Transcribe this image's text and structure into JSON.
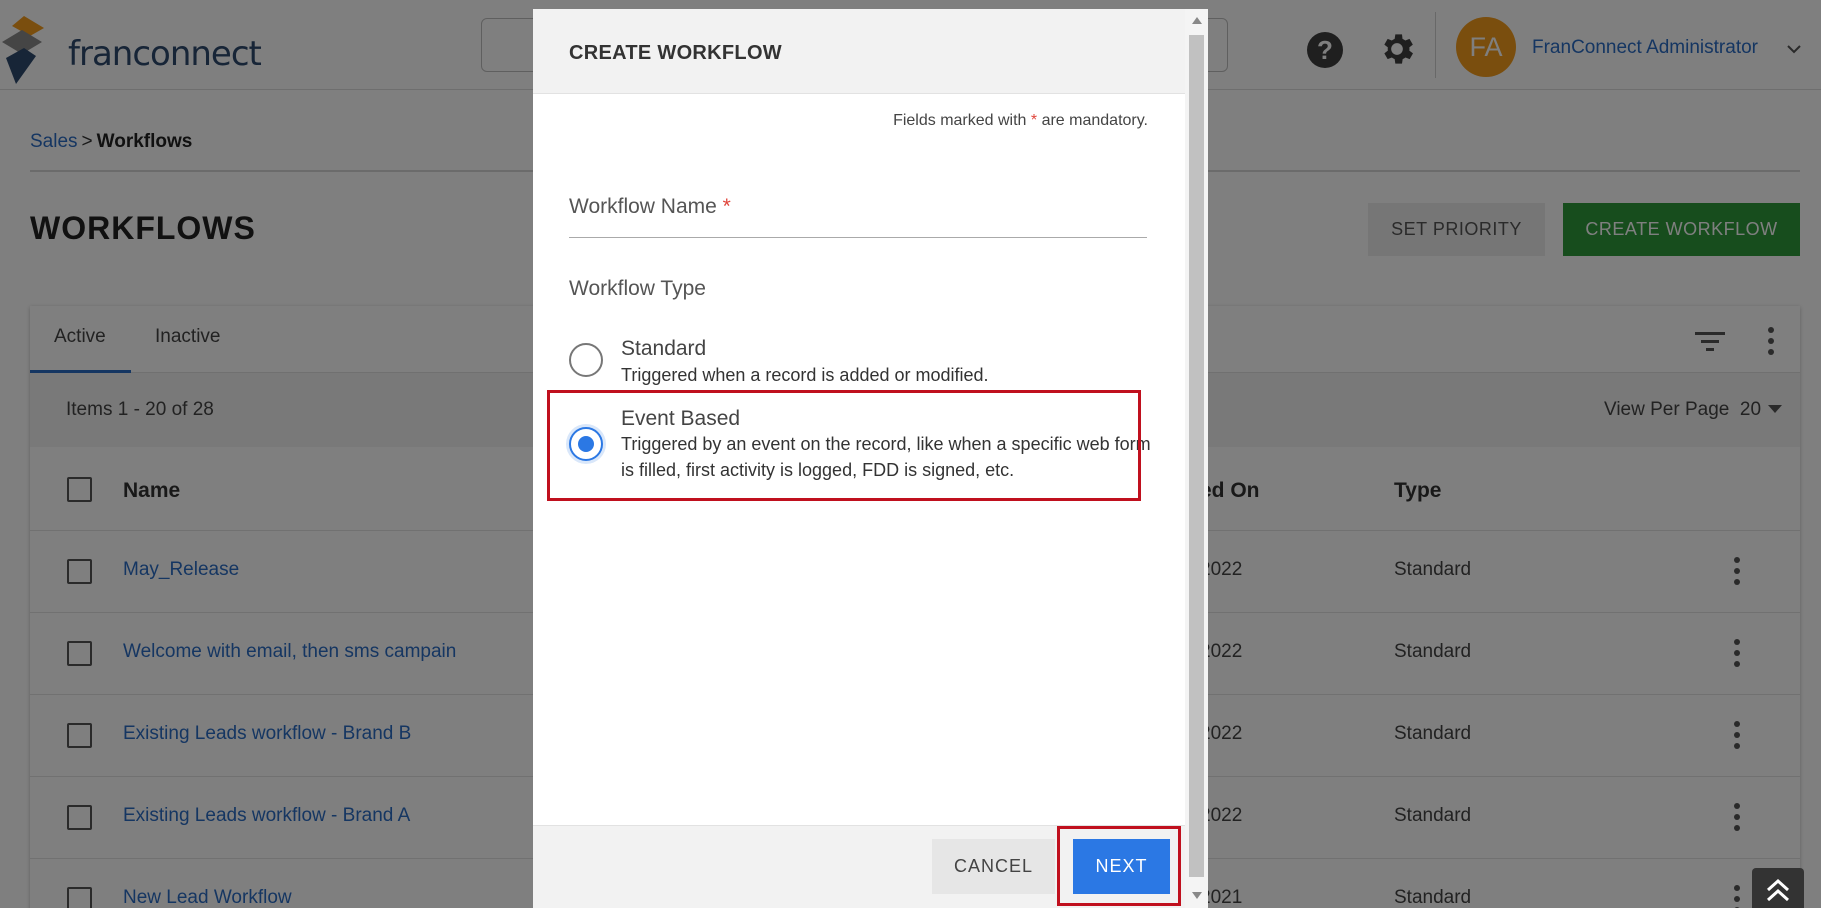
{
  "header": {
    "logo_text": "franconnect",
    "avatar_initials": "FA",
    "user_name": "FranConnect Administrator",
    "help_glyph": "?"
  },
  "breadcrumb": {
    "parent": "Sales",
    "separator": ">",
    "current": "Workflows"
  },
  "page": {
    "title": "WORKFLOWS",
    "set_priority_label": "SET PRIORITY",
    "create_workflow_label": "CREATE WORKFLOW"
  },
  "tabs": [
    {
      "label": "Active",
      "active": true
    },
    {
      "label": "Inactive",
      "active": false
    }
  ],
  "list": {
    "items_count": "Items 1 - 20 of 28",
    "view_per_page_label": "View Per Page",
    "view_per_page_value": "20",
    "columns": {
      "name": "Name",
      "modified_on": "ed On",
      "type": "Type"
    },
    "rows": [
      {
        "name": "May_Release",
        "date": "2022",
        "type": "Standard"
      },
      {
        "name": "Welcome with email, then sms campain",
        "date": "2022",
        "type": "Standard"
      },
      {
        "name": "Existing Leads workflow - Brand B",
        "date": "2022",
        "type": "Standard"
      },
      {
        "name": "Existing Leads workflow - Brand A",
        "date": "2022",
        "type": "Standard"
      },
      {
        "name": "New Lead Workflow",
        "date": "2021",
        "type": "Standard"
      }
    ]
  },
  "modal": {
    "title": "CREATE WORKFLOW",
    "mandatory_prefix": "Fields marked with",
    "mandatory_star": "*",
    "mandatory_suffix": "are mandatory.",
    "workflow_name_label": "Workflow Name",
    "required_star": "*",
    "workflow_type_label": "Workflow Type",
    "options": [
      {
        "title": "Standard",
        "description": "Triggered when a record is added or modified.",
        "selected": false
      },
      {
        "title": "Event Based",
        "description": "Triggered by an event on the record, like when a specific web form is filled, first activity is logged, FDD is signed, etc.",
        "selected": true
      }
    ],
    "cancel_label": "CANCEL",
    "next_label": "NEXT"
  },
  "colors": {
    "primary_blue": "#2b78e4",
    "link_blue": "#2b6cc4",
    "create_green": "#2e9b3b",
    "highlight_red": "#c0101e",
    "avatar_orange": "#f49c1c"
  }
}
